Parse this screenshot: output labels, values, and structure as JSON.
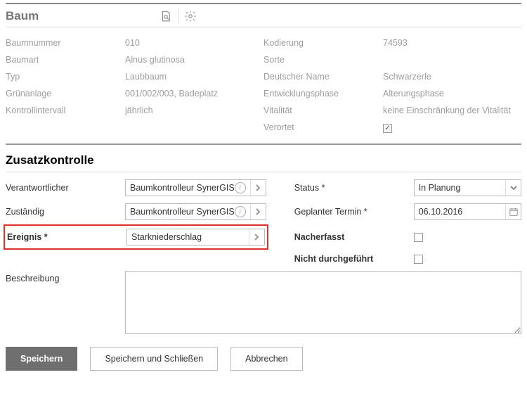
{
  "header": {
    "title": "Baum"
  },
  "details": {
    "left": [
      {
        "label": "Baumnummer",
        "value": "010"
      },
      {
        "label": "Baumart",
        "value": "Alnus glutinosa"
      },
      {
        "label": "Typ",
        "value": "Laubbaum"
      },
      {
        "label": "Grünanlage",
        "value": "001/002/003, Badeplatz"
      },
      {
        "label": "Kontrollintervall",
        "value": "jährlich"
      }
    ],
    "right": [
      {
        "label": "Kodierung",
        "value": "74593"
      },
      {
        "label": "Sorte",
        "value": ""
      },
      {
        "label": "Deutscher Name",
        "value": "Schwarzerle"
      },
      {
        "label": "Entwicklungsphase",
        "value": "Alterungsphase"
      },
      {
        "label": "Vitalität",
        "value": "keine Einschränkung der Vitalität"
      },
      {
        "label": "Verortet",
        "value": "__check__"
      }
    ]
  },
  "sectionTitle": "Zusatzkontrolle",
  "form": {
    "verantwortlicher": {
      "label": "Verantwortlicher",
      "value": "Baumkontrolleur SynerGIS"
    },
    "zustaendig": {
      "label": "Zuständig",
      "value": "Baumkontrolleur SynerGIS"
    },
    "ereignis": {
      "label": "Ereignis *",
      "value": "Starkniederschlag"
    },
    "status": {
      "label": "Status *",
      "value": "In Planung"
    },
    "termin": {
      "label": "Geplanter Termin *",
      "value": "06.10.2016"
    },
    "nacherfasst": {
      "label": "Nacherfasst"
    },
    "nichtDurchgefuehrt": {
      "label": "Nicht durchgeführt"
    },
    "beschreibung": {
      "label": "Beschreibung",
      "value": ""
    }
  },
  "actions": {
    "save": "Speichern",
    "saveClose": "Speichern und Schließen",
    "cancel": "Abbrechen"
  }
}
